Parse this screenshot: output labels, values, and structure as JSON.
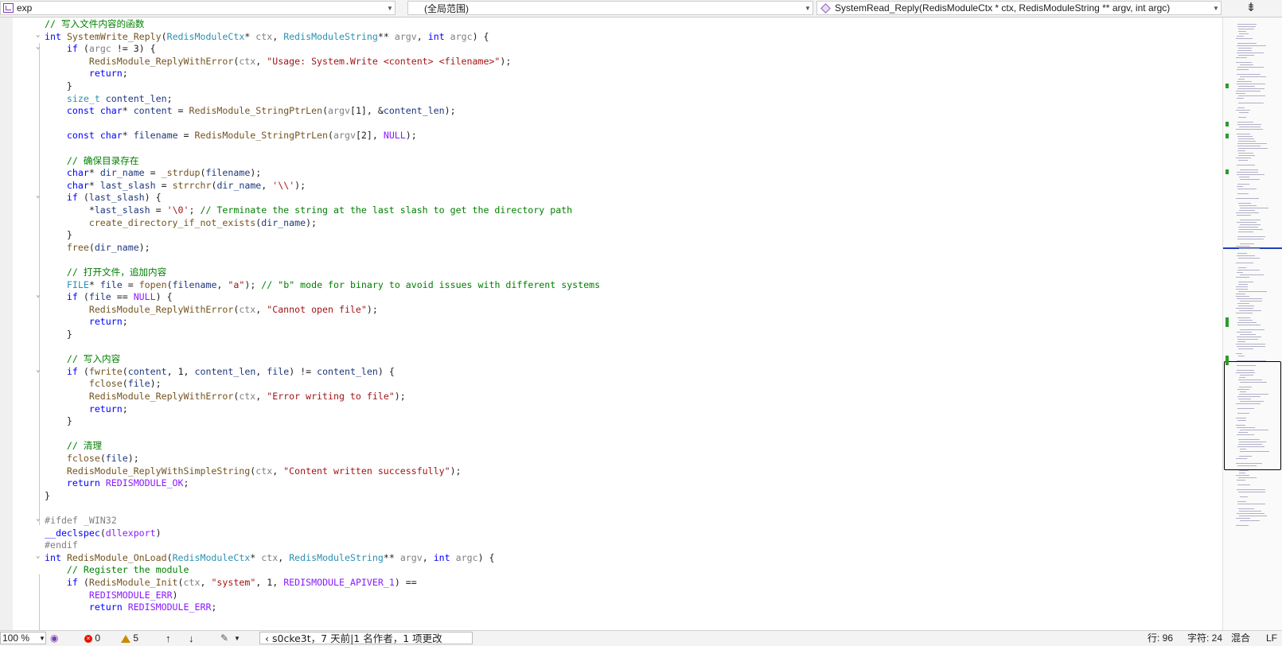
{
  "navbar": {
    "project": "exp",
    "scope": "(全局范围)",
    "member": "SystemRead_Reply(RedisModuleCtx * ctx, RedisModuleString ** argv, int argc)",
    "split_icon": "split-editor-icon"
  },
  "status": {
    "zoom": "100 %",
    "errors": "0",
    "warnings": "5",
    "git_info": "s0cke3t，7 天前|1 名作者，1 项更改",
    "line": "行: 96",
    "char": "字符: 24",
    "mixed": "混合",
    "eol": "LF"
  },
  "code_lines": [
    {
      "fold": "",
      "t": "// 写入文件内容的函数",
      "c": "cm"
    },
    {
      "fold": "v",
      "t": "int SystemWrite_Reply(RedisModuleCtx* ctx, RedisModuleString** argv, int argc) {"
    },
    {
      "fold": "v",
      "t": "    if (argc != 3) {"
    },
    {
      "fold": "",
      "t": "        RedisModule_ReplyWithError(ctx, \"Usage: System.Write <content> <filename>\");"
    },
    {
      "fold": "",
      "t": "        return;"
    },
    {
      "fold": "",
      "t": "    }"
    },
    {
      "fold": "",
      "t": "    size_t content_len;"
    },
    {
      "fold": "",
      "t": "    const char* content = RedisModule_StringPtrLen(argv[1], &content_len);"
    },
    {
      "fold": "",
      "t": ""
    },
    {
      "fold": "",
      "t": "    const char* filename = RedisModule_StringPtrLen(argv[2], NULL);"
    },
    {
      "fold": "",
      "t": ""
    },
    {
      "fold": "",
      "t": "    // 确保目录存在",
      "c": "cm"
    },
    {
      "fold": "",
      "t": "    char* dir_name = _strdup(filename);"
    },
    {
      "fold": "",
      "t": "    char* last_slash = strrchr(dir_name, '\\\\');"
    },
    {
      "fold": "v",
      "t": "    if (last_slash) {"
    },
    {
      "fold": "",
      "t": "        *last_slash = '\\0'; // Terminate the string at the last slash to get the directory path"
    },
    {
      "fold": "",
      "t": "        create_directory_if_not_exists(dir_name);"
    },
    {
      "fold": "",
      "t": "    }"
    },
    {
      "fold": "",
      "t": "    free(dir_name);"
    },
    {
      "fold": "",
      "t": ""
    },
    {
      "fold": "",
      "t": "    // 打开文件，追加内容",
      "c": "cm"
    },
    {
      "fold": "",
      "t": "    FILE* file = fopen(filename, \"a\"); // \"b\" mode for binary to avoid issues with different systems"
    },
    {
      "fold": "v",
      "t": "    if (file == NULL) {"
    },
    {
      "fold": "",
      "t": "        RedisModule_ReplyWithError(ctx, \"Cannot open file\");"
    },
    {
      "fold": "",
      "t": "        return;"
    },
    {
      "fold": "",
      "t": "    }"
    },
    {
      "fold": "",
      "t": ""
    },
    {
      "fold": "",
      "t": "    // 写入内容",
      "c": "cm"
    },
    {
      "fold": "v",
      "t": "    if (fwrite(content, 1, content_len, file) != content_len) {"
    },
    {
      "fold": "",
      "t": "        fclose(file);"
    },
    {
      "fold": "",
      "t": "        RedisModule_ReplyWithError(ctx, \"Error writing to file\");"
    },
    {
      "fold": "",
      "t": "        return;"
    },
    {
      "fold": "",
      "t": "    }"
    },
    {
      "fold": "",
      "t": ""
    },
    {
      "fold": "",
      "t": "    // 清理",
      "c": "cm"
    },
    {
      "fold": "",
      "t": "    fclose(file);"
    },
    {
      "fold": "",
      "t": "    RedisModule_ReplyWithSimpleString(ctx, \"Content written successfully\");"
    },
    {
      "fold": "",
      "t": "    return REDISMODULE_OK;"
    },
    {
      "fold": "",
      "t": "}"
    },
    {
      "fold": "",
      "t": ""
    },
    {
      "fold": "v",
      "t": "#ifdef _WIN32",
      "c": "pp"
    },
    {
      "fold": "",
      "t": "__declspec(dllexport)"
    },
    {
      "fold": "",
      "t": "#endif",
      "c": "pp"
    },
    {
      "fold": "v",
      "t": "int RedisModule_OnLoad(RedisModuleCtx* ctx, RedisModuleString** argv, int argc) {"
    },
    {
      "fold": "",
      "t": "    // Register the module",
      "c": "cm"
    },
    {
      "fold": "",
      "t": "    if (RedisModule_Init(ctx, \"system\", 1, REDISMODULE_APIVER_1) =="
    },
    {
      "fold": "",
      "t": "        REDISMODULE_ERR)"
    },
    {
      "fold": "",
      "t": "        return REDISMODULE_ERR;"
    }
  ]
}
